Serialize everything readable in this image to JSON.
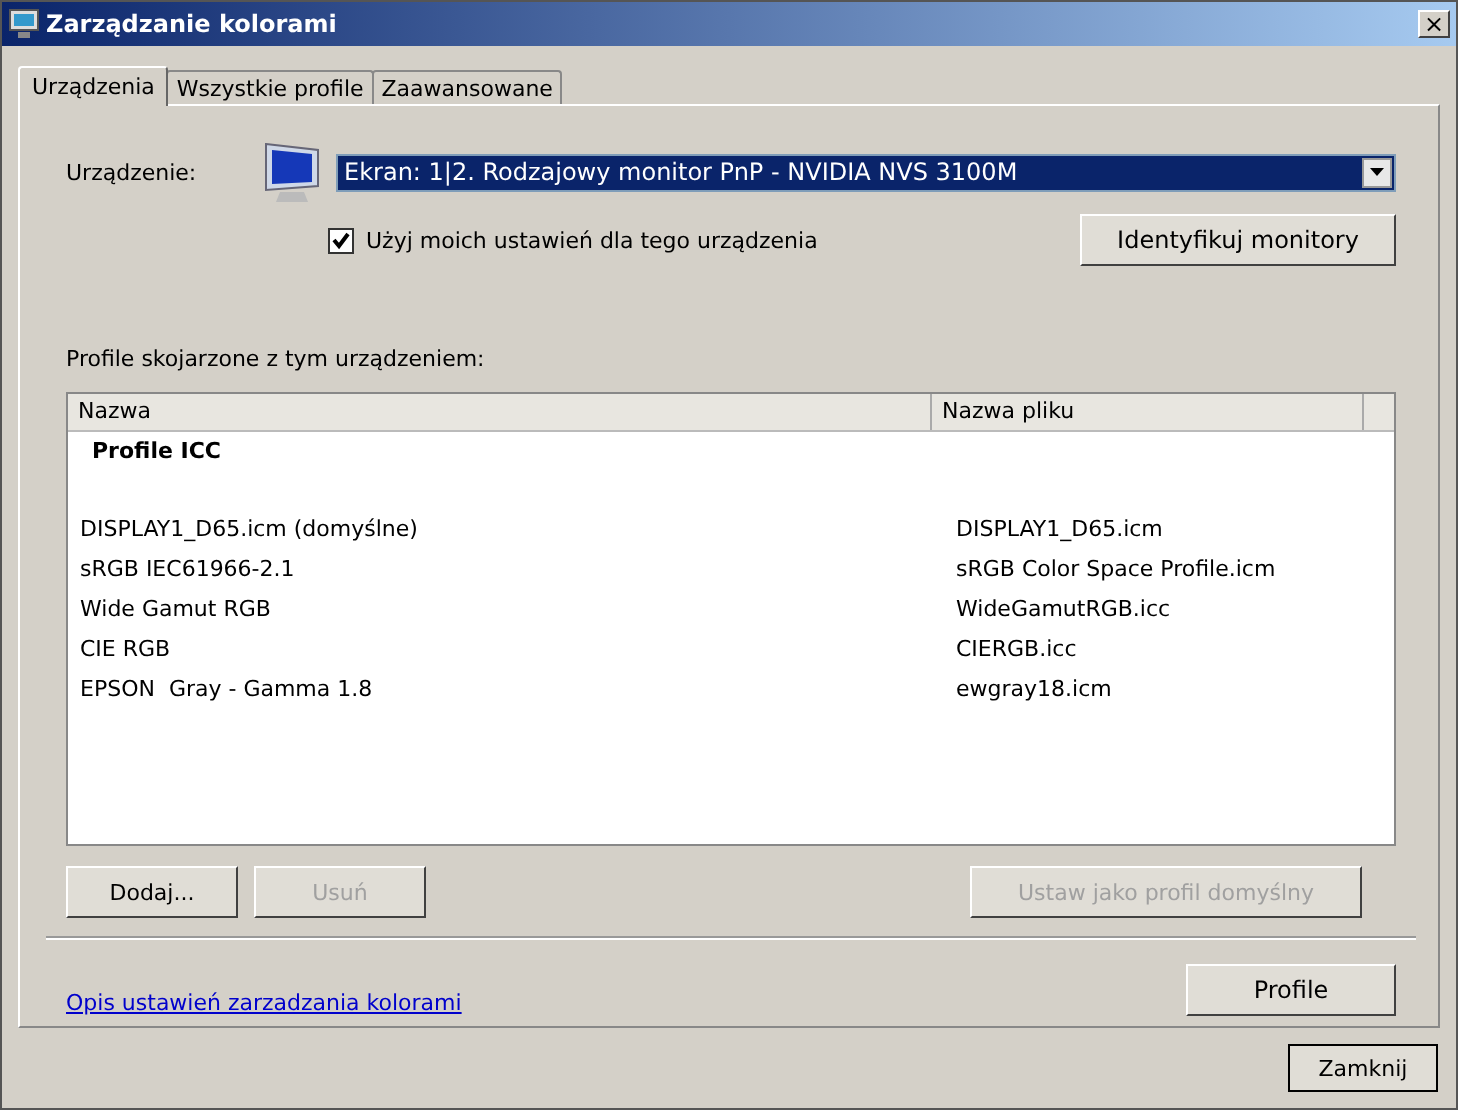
{
  "window": {
    "title": "Zarządzanie kolorami",
    "close": "×"
  },
  "tabs": [
    {
      "label": "Urządzenia",
      "selected": true
    },
    {
      "label": "Wszystkie profile",
      "selected": false
    },
    {
      "label": "Zaawansowane",
      "selected": false
    }
  ],
  "device": {
    "label": "Urządzenie:",
    "value": "Ekran: 1|2. Rodzajowy monitor PnP - NVIDIA NVS 3100M",
    "use_my_settings": {
      "label": "Użyj moich ustawień dla tego urządzenia",
      "checked": true
    },
    "identify_button": "Identyfikuj monitory"
  },
  "profiles": {
    "label": "Profile skojarzone z tym urządzeniem:",
    "columns": [
      "Nazwa",
      "Nazwa pliku"
    ],
    "group": "Profile ICC",
    "rows": [
      {
        "name": "DISPLAY1_D65.icm (domyślne)",
        "file": "DISPLAY1_D65.icm"
      },
      {
        "name": "sRGB IEC61966-2.1",
        "file": "sRGB Color Space Profile.icm"
      },
      {
        "name": "Wide Gamut RGB",
        "file": "WideGamutRGB.icc"
      },
      {
        "name": "CIE RGB",
        "file": "CIERGB.icc"
      },
      {
        "name": "EPSON  Gray - Gamma 1.8",
        "file": "ewgray18.icm"
      }
    ]
  },
  "buttons": [
    {
      "label": "Dodaj...",
      "disabled": false
    },
    {
      "label": "Usuń",
      "disabled": true
    },
    {
      "label": "Ustaw jako profil domyślny",
      "disabled": true
    }
  ],
  "link": "Opis ustawień zarzadzania kolorami",
  "profile_button": "Profile",
  "close_button": "Zamknij"
}
